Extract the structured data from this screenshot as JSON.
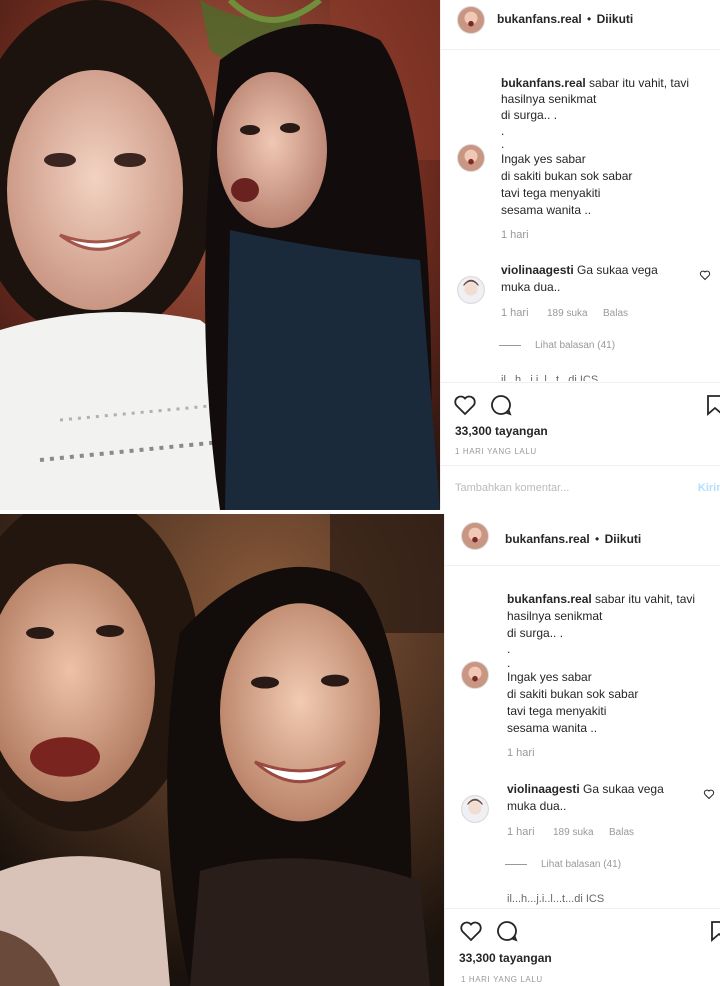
{
  "post": {
    "username": "bukanfans.real",
    "dot": "•",
    "follow_status": "Diikuti"
  },
  "caption": {
    "username": "bukanfans.real",
    "line1": "sabar itu vahit, tavi",
    "line2": "hasilnya senikmat",
    "line3": "di surga.. .",
    "line4": ".",
    "line5": ".",
    "line6": "Ingak yes sabar",
    "line7": "di sakiti bukan sok sabar",
    "line8": "tavi tega menyakiti",
    "line9": "sesama wanita ..",
    "time": "1 hari"
  },
  "comment": {
    "username": "violinaagesti",
    "text_line1": "Ga sukaa vega",
    "text_line2": "muka dua..",
    "time": "1 hari",
    "likes": "189 suka",
    "reply": "Balas",
    "view_replies": "Lihat balasan (41)"
  },
  "next_comment_cut": "il...h...j.i..l...t...di ICS",
  "views": "33,300 tayangan",
  "posted": "1 HARI YANG LALU",
  "add_comment": {
    "placeholder": "Tambahkan komentar...",
    "post_label": "Kirim"
  },
  "icons": {
    "like": "heart-icon",
    "comment": "comment-bubble-icon",
    "save": "bookmark-icon",
    "comment_like": "small-heart-icon"
  },
  "colors": {
    "text": "#262626",
    "muted": "#999999",
    "border": "#efefef",
    "post_button": "#b2dffc"
  }
}
